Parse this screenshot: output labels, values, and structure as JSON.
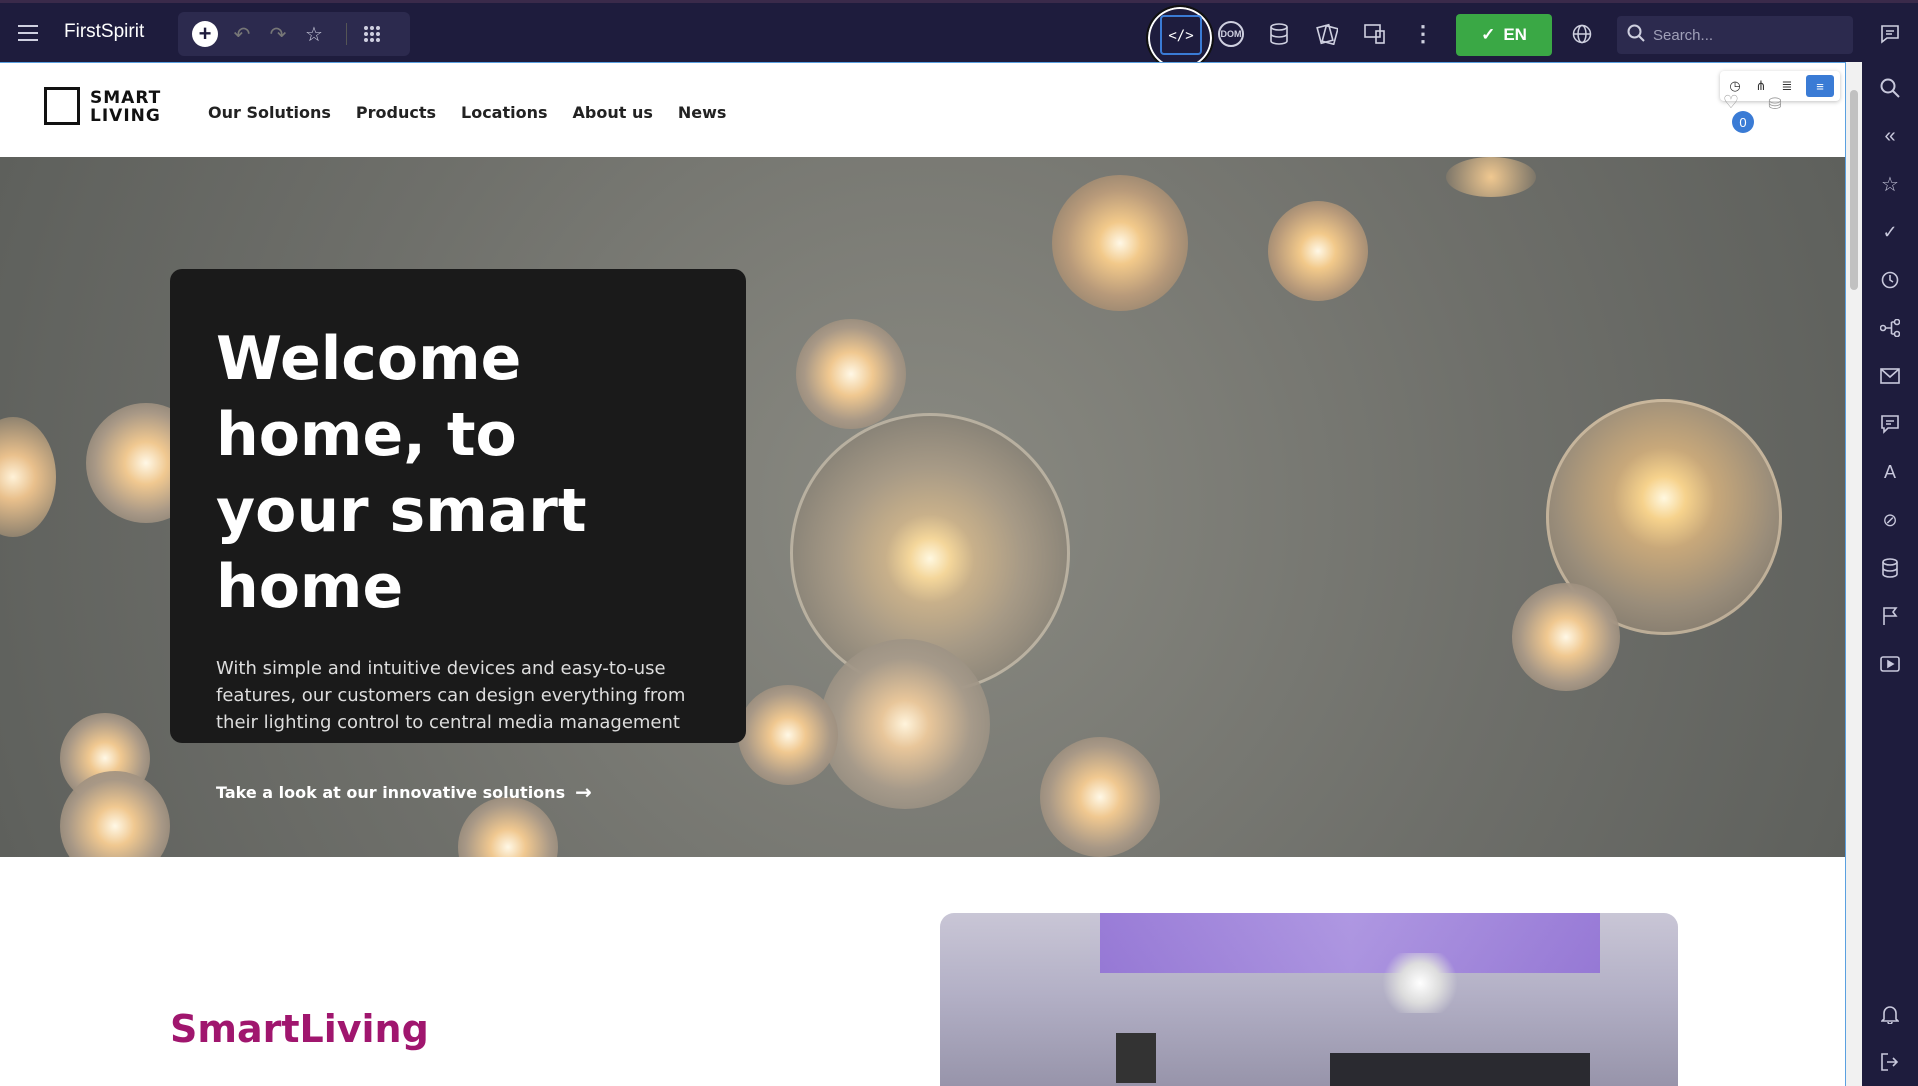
{
  "app": {
    "brand": "FirstSpirit",
    "language": "EN",
    "search_placeholder": "Search...",
    "dom_label": "DOM"
  },
  "colors": {
    "topbar": "#1e1c3d",
    "accent_green": "#3aa845",
    "accent_blue": "#3a7bd5",
    "brand_magenta": "#a0166e"
  },
  "toolbar_icons": [
    "menu-icon",
    "add-icon",
    "undo-icon",
    "redo-icon",
    "star-icon",
    "apps-grid-icon",
    "code-view-icon",
    "dom-icon",
    "database-icon",
    "pages-icon",
    "devices-icon",
    "more-vertical-icon",
    "check-icon",
    "globe-icon",
    "search-icon"
  ],
  "rail_icons": [
    "comment-icon",
    "search-icon",
    "collapse-icon",
    "star-icon",
    "check-icon",
    "clock-icon",
    "share-tree-icon",
    "mail-icon",
    "chat-icon",
    "translate-icon",
    "bookmark-icon",
    "database-icon",
    "flag-icon",
    "play-icon",
    "bell-icon",
    "logout-icon"
  ],
  "site": {
    "logo_line1": "SMART",
    "logo_line2": "LIVING",
    "nav": [
      "Our Solutions",
      "Products",
      "Locations",
      "About us",
      "News"
    ],
    "cart_count": "0",
    "hero": {
      "title": "Welcome home, to your smart home",
      "text": "With simple and intuitive devices and easy-to-use features, our customers can design everything from their lighting control to central media management",
      "cta": "Take a look at our innovative solutions"
    },
    "section_title": "SmartLiving"
  }
}
